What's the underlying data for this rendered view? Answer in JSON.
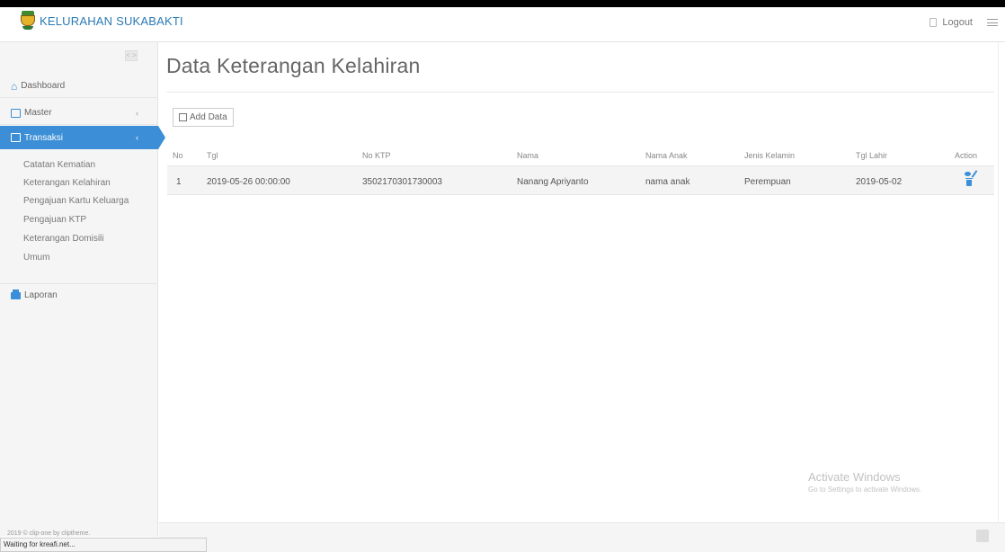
{
  "header": {
    "brand": "KELURAHAN SUKABAKTI",
    "logout_label": "Logout",
    "logout_icon": "logout-icon",
    "menu_icon": "menu-icon"
  },
  "sidebar": {
    "collapse_label": "< >",
    "items": [
      {
        "label": "Dashboard",
        "icon": "home-icon"
      },
      {
        "label": "Master",
        "icon": "edit-icon",
        "chevron": "‹"
      },
      {
        "label": "Transaksi",
        "icon": "edit-icon",
        "chevron": "‹",
        "active": true
      },
      {
        "label": "Laporan",
        "icon": "printer-icon"
      }
    ],
    "submenu": [
      "Catatan Kematian",
      "Keterangan Kelahiran",
      "Pengajuan Kartu Keluarga",
      "Pengajuan KTP",
      "Keterangan Domisili",
      "Umum"
    ],
    "footer": "2019 © clip-one by cliptheme."
  },
  "status_bar": "Waiting for kreafi.net...",
  "main": {
    "title": "Data Keterangan Kelahiran",
    "add_button": "Add Data",
    "table": {
      "headers": [
        "No",
        "Tgl",
        "No KTP",
        "Nama",
        "Nama Anak",
        "Jenis Kelamin",
        "Tgl Lahir",
        "Action"
      ],
      "rows": [
        [
          "1",
          "2019-05-26 00:00:00",
          "3502170301730003",
          "Nanang Apriyanto",
          "nama anak",
          "Perempuan",
          "2019-05-02"
        ]
      ]
    }
  },
  "watermark": {
    "title": "Activate Windows",
    "subtitle": "Go to Settings to activate Windows."
  },
  "colors": {
    "accent": "#3c8fd6",
    "brand_text": "#2a7ab5"
  }
}
